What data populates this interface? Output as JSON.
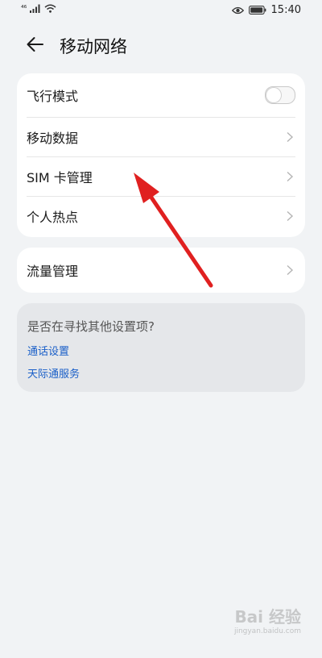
{
  "status_bar": {
    "signal_label": "⁴⁶",
    "time": "15:40",
    "icons": [
      "signal-icon",
      "wifi-icon",
      "eye-icon",
      "battery-icon"
    ]
  },
  "header": {
    "title": "移动网络",
    "back_icon": "back-arrow-icon"
  },
  "main_card": {
    "items": [
      {
        "label": "飞行模式",
        "control": "toggle",
        "toggle_on": false
      },
      {
        "label": "移动数据",
        "control": "chevron"
      },
      {
        "label": "SIM 卡管理",
        "control": "chevron"
      },
      {
        "label": "个人热点",
        "control": "chevron"
      }
    ]
  },
  "traffic_card": {
    "label": "流量管理"
  },
  "suggestion_card": {
    "title": "是否在寻找其他设置项?",
    "links": [
      "通话设置",
      "天际通服务"
    ]
  },
  "watermark": {
    "text": "Bai 经验",
    "sub": "jingyan.baidu.com"
  },
  "colors": {
    "background": "#f1f3f5",
    "card": "#ffffff",
    "link": "#1a5fc8",
    "annotation_arrow": "#e02020"
  }
}
